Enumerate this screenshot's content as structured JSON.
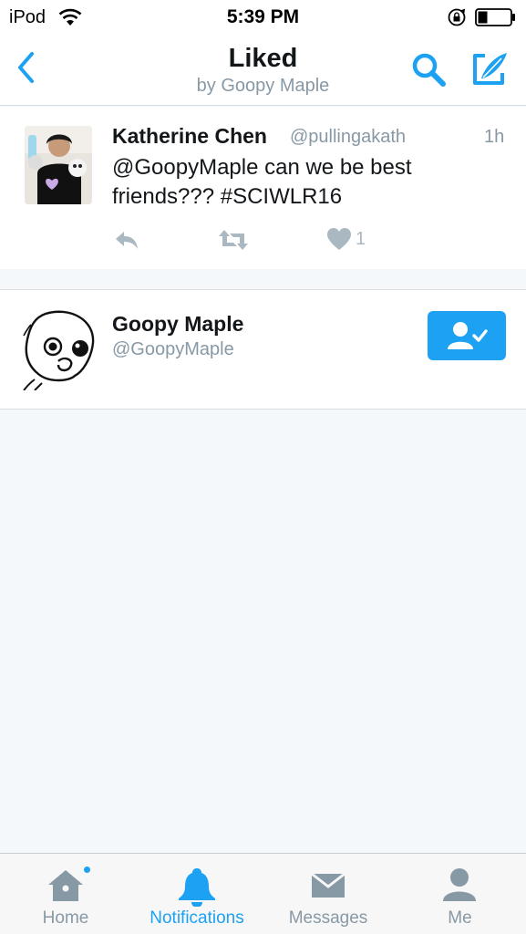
{
  "status_bar": {
    "carrier": "iPod",
    "time": "5:39 PM"
  },
  "nav": {
    "title": "Liked",
    "subtitle": "by Goopy Maple"
  },
  "tweet": {
    "name": "Katherine Chen",
    "handle": "@pullingakath",
    "time": "1h",
    "text": "@GoopyMaple can we be best friends??? #SCIWLR16",
    "like_count": "1"
  },
  "user": {
    "name": "Goopy Maple",
    "handle": "@GoopyMaple"
  },
  "tabs": [
    {
      "label": "Home",
      "icon": "home-icon",
      "active": false,
      "badge": true
    },
    {
      "label": "Notifications",
      "icon": "bell-icon",
      "active": true
    },
    {
      "label": "Messages",
      "icon": "envelope-icon",
      "active": false
    },
    {
      "label": "Me",
      "icon": "person-icon",
      "active": false
    }
  ],
  "colors": {
    "accent": "#1da1f2",
    "muted": "#8899a6",
    "background": "#f5f8fa"
  }
}
